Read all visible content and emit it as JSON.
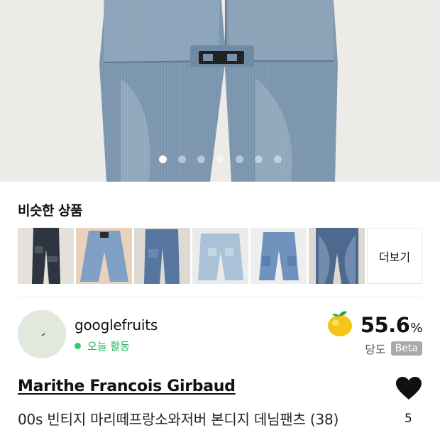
{
  "carousel": {
    "total_dots": 7,
    "active_index": 0
  },
  "similar": {
    "title": "비슷한 상품",
    "more_label": "더보기",
    "items_count": 6
  },
  "seller": {
    "name": "googlefruits",
    "activity": "오늘 활동",
    "sweetness_value": "55.6",
    "sweetness_unit": "%",
    "sweetness_label": "당도",
    "beta_badge": "Beta"
  },
  "product": {
    "brand": "Marithe Francois Girbaud",
    "title": "00s 빈티지 마리떼프랑소와저버 본디지 데님팬츠 (38)",
    "like_count": "5"
  },
  "colors": {
    "accent_green": "#1fb463",
    "denim": "#7d97b0",
    "badge_gray": "#a9a9a9"
  },
  "icons": [
    "heart-icon",
    "fruit-icon",
    "status-dot-icon"
  ]
}
